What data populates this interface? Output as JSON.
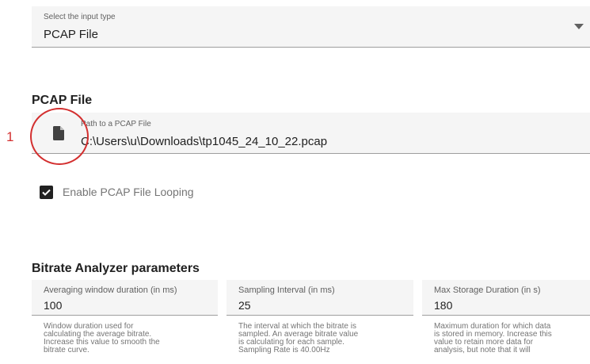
{
  "input_type": {
    "label": "Select the input type",
    "value": "PCAP File"
  },
  "pcap_section": {
    "title": "PCAP File",
    "path_label": "Path to a PCAP File",
    "path_value": "C:\\Users\\u\\Downloads\\tp1045_24_10_22.pcap",
    "file_icon": "file-icon",
    "looping": {
      "label": "Enable PCAP File Looping",
      "checked": true
    }
  },
  "annotation": {
    "number": "1",
    "color": "#d32f2f"
  },
  "bitrate_section": {
    "title": "Bitrate Analyzer parameters",
    "fields": [
      {
        "label": "Averaging window duration (in ms)",
        "value": "100",
        "help": [
          "Window duration used for",
          "calculating the average bitrate.",
          "Increase this value to smooth the",
          "bitrate curve."
        ]
      },
      {
        "label": "Sampling Interval (in ms)",
        "value": "25",
        "help": [
          "The interval at which the bitrate is",
          "sampled. An average bitrate value",
          "is calculating for each sample.",
          "Sampling Rate is 40.00Hz"
        ]
      },
      {
        "label": "Max Storage Duration (in s)",
        "value": "180",
        "help": [
          "Maximum duration for which data",
          "is stored in memory. Increase this",
          "value to retain more data for",
          "analysis, but note that it will"
        ]
      }
    ]
  }
}
